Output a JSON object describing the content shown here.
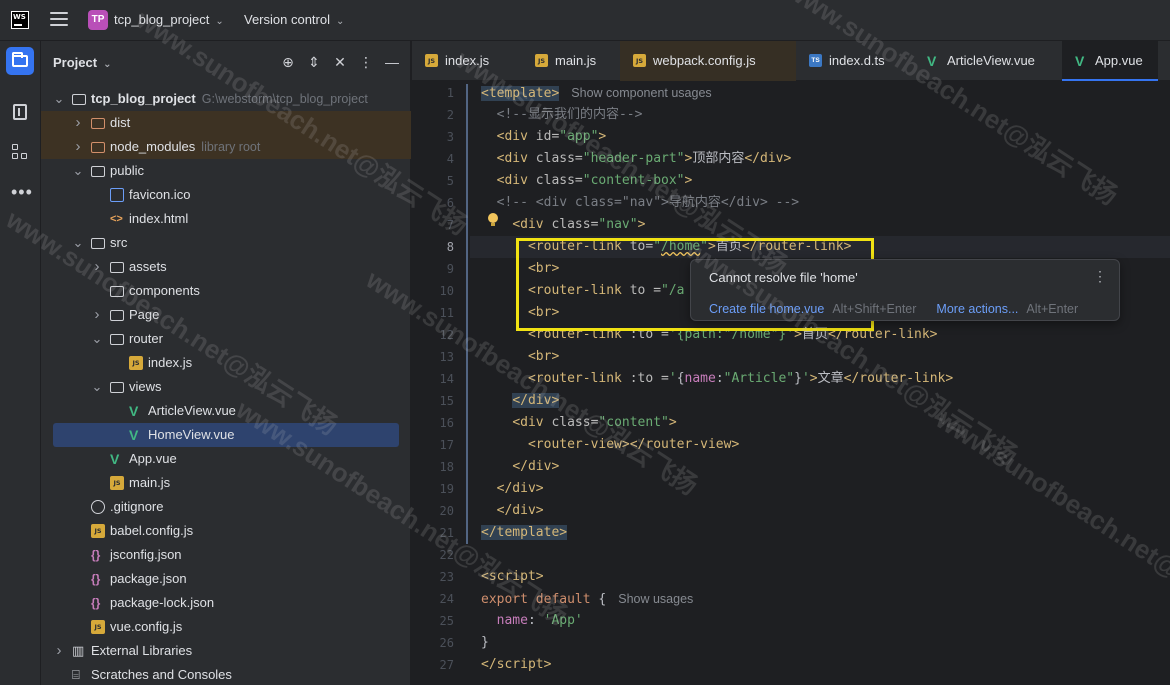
{
  "topbar": {
    "logo": "WS",
    "project_badge": "TP",
    "project_name": "tcp_blog_project",
    "vcs_label": "Version control"
  },
  "project_panel": {
    "title": "Project",
    "tree": [
      {
        "label": "tcp_blog_project",
        "hint": "G:\\webstorm\\tcp_blog_project",
        "icon": "folder-icon",
        "depth": 0,
        "arrow": "down",
        "bold": true
      },
      {
        "label": "dist",
        "hint": "",
        "icon": "excluded-folder-icon",
        "depth": 1,
        "arrow": "right",
        "excluded": true
      },
      {
        "label": "node_modules",
        "hint": "library root",
        "icon": "excluded-folder-icon",
        "depth": 1,
        "arrow": "right",
        "excluded": true
      },
      {
        "label": "public",
        "hint": "",
        "icon": "folder-icon",
        "depth": 1,
        "arrow": "down"
      },
      {
        "label": "favicon.ico",
        "hint": "",
        "icon": "image-file-icon",
        "depth": 2,
        "arrow": "none"
      },
      {
        "label": "index.html",
        "hint": "",
        "icon": "html-file-icon",
        "depth": 2,
        "arrow": "none"
      },
      {
        "label": "src",
        "hint": "",
        "icon": "folder-icon",
        "depth": 1,
        "arrow": "down"
      },
      {
        "label": "assets",
        "hint": "",
        "icon": "folder-icon",
        "depth": 2,
        "arrow": "right"
      },
      {
        "label": "components",
        "hint": "",
        "icon": "folder-icon",
        "depth": 2,
        "arrow": "none"
      },
      {
        "label": "Page",
        "hint": "",
        "icon": "folder-icon",
        "depth": 2,
        "arrow": "right"
      },
      {
        "label": "router",
        "hint": "",
        "icon": "folder-icon",
        "depth": 2,
        "arrow": "down"
      },
      {
        "label": "index.js",
        "hint": "",
        "icon": "js-file-icon",
        "depth": 3,
        "arrow": "none"
      },
      {
        "label": "views",
        "hint": "",
        "icon": "folder-icon",
        "depth": 2,
        "arrow": "down"
      },
      {
        "label": "ArticleView.vue",
        "hint": "",
        "icon": "vue-file-icon",
        "depth": 3,
        "arrow": "none"
      },
      {
        "label": "HomeView.vue",
        "hint": "",
        "icon": "vue-file-icon",
        "depth": 3,
        "arrow": "none",
        "selected": true
      },
      {
        "label": "App.vue",
        "hint": "",
        "icon": "vue-file-icon",
        "depth": 2,
        "arrow": "none"
      },
      {
        "label": "main.js",
        "hint": "",
        "icon": "js-file-icon",
        "depth": 2,
        "arrow": "none"
      },
      {
        "label": ".gitignore",
        "hint": "",
        "icon": "ignore-file-icon",
        "depth": 1,
        "arrow": "none"
      },
      {
        "label": "babel.config.js",
        "hint": "",
        "icon": "js-file-icon",
        "depth": 1,
        "arrow": "none"
      },
      {
        "label": "jsconfig.json",
        "hint": "",
        "icon": "json-file-icon",
        "depth": 1,
        "arrow": "none"
      },
      {
        "label": "package.json",
        "hint": "",
        "icon": "json-file-icon",
        "depth": 1,
        "arrow": "none"
      },
      {
        "label": "package-lock.json",
        "hint": "",
        "icon": "json-file-icon",
        "depth": 1,
        "arrow": "none"
      },
      {
        "label": "vue.config.js",
        "hint": "",
        "icon": "js-file-icon",
        "depth": 1,
        "arrow": "none"
      },
      {
        "label": "External Libraries",
        "hint": "",
        "icon": "library-icon",
        "depth": 0,
        "arrow": "right"
      },
      {
        "label": "Scratches and Consoles",
        "hint": "",
        "icon": "scratches-icon",
        "depth": 0,
        "arrow": "none"
      }
    ]
  },
  "tabs": [
    {
      "label": "index.js",
      "icon": "js"
    },
    {
      "label": "main.js",
      "icon": "js"
    },
    {
      "label": "webpack.config.js",
      "icon": "js",
      "modified": true
    },
    {
      "label": "index.d.ts",
      "icon": "ts"
    },
    {
      "label": "ArticleView.vue",
      "icon": "vue"
    },
    {
      "label": "App.vue",
      "icon": "vue",
      "active": true
    }
  ],
  "editor": {
    "line_numbers": [
      "1",
      "2",
      "3",
      "4",
      "5",
      "6",
      "7",
      "8",
      "9",
      "10",
      "11",
      "12",
      "13",
      "14",
      "15",
      "16",
      "17",
      "18",
      "19",
      "20",
      "21",
      "22",
      "23",
      "24",
      "25",
      "26",
      "27"
    ],
    "current_line": "8",
    "hints": {
      "template_usages": "Show component usages",
      "export_usages": "Show usages"
    },
    "code": {
      "l2": "<!--显示我们的内容-->",
      "l4_text": "顶部内容",
      "l6": "<!-- <div class=\"nav\">导航内容</div> -->",
      "l8_text": "首页",
      "l12_text": "首页",
      "l14_text": "文章"
    }
  },
  "popup": {
    "message": "Cannot resolve file 'home'",
    "action1": "Create file home.vue",
    "action1_keys": "Alt+Shift+Enter",
    "action2": "More actions...",
    "action2_keys": "Alt+Enter"
  },
  "watermark": "www.sunofbeach.net@泓云飞扬",
  "colors": {
    "accent": "#3574f0",
    "highlight_box": "#f1e213",
    "vue": "#41b883"
  }
}
